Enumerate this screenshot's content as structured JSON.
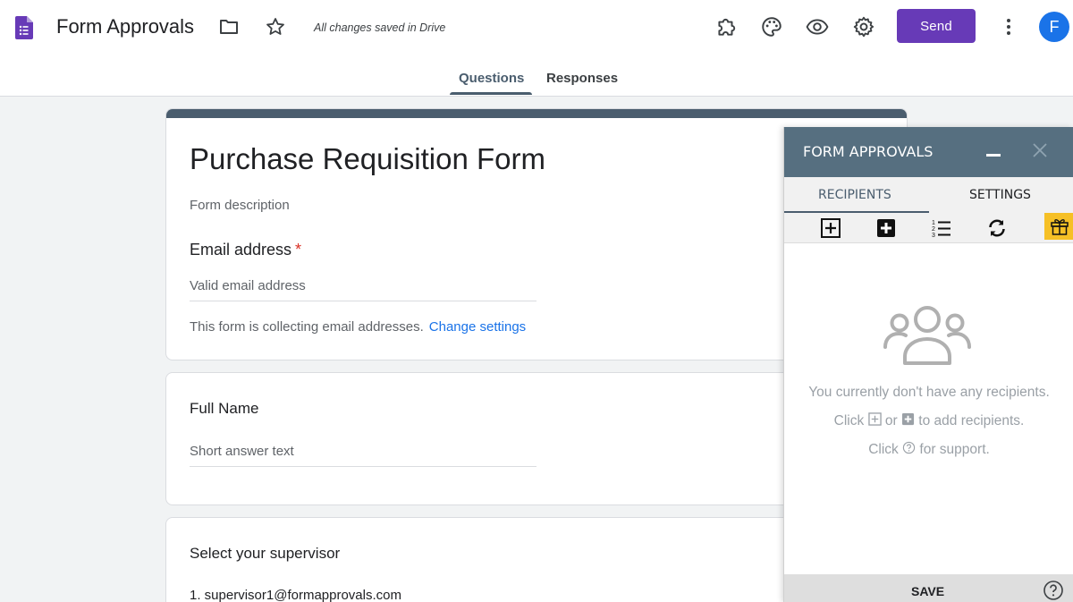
{
  "header": {
    "app_title": "Form Approvals",
    "saved_status": "All changes saved in Drive",
    "send_label": "Send",
    "avatar_initial": "F",
    "icons": [
      "forms-icon",
      "folder-icon",
      "star-icon",
      "addon-icon",
      "palette-icon",
      "preview-icon",
      "settings-icon",
      "more-vert-icon"
    ]
  },
  "tabs": [
    {
      "label": "Questions",
      "active": true
    },
    {
      "label": "Responses",
      "active": false
    }
  ],
  "form": {
    "title": "Purchase Requisition Form",
    "description": "Form description",
    "email_question": {
      "label": "Email address",
      "required_marker": "*",
      "placeholder": "Valid email address",
      "note": "This form is collecting email addresses.",
      "link": "Change settings"
    },
    "full_name_question": {
      "label": "Full Name",
      "placeholder": "Short answer text"
    },
    "supervisor_question": {
      "label": "Select your supervisor",
      "options": [
        "1.  supervisor1@formapprovals.com"
      ]
    }
  },
  "panel": {
    "title": "FORM APPROVALS",
    "tabs": [
      {
        "label": "RECIPIENTS",
        "active": true
      },
      {
        "label": "SETTINGS",
        "active": false
      }
    ],
    "toolbar_icons": [
      "add-outline-icon",
      "add-filled-icon",
      "numbered-list-icon",
      "refresh-icon",
      "gift-icon"
    ],
    "empty_line1": "You currently don't have any recipients.",
    "empty_line2_a": "Click",
    "empty_line2_b": "or",
    "empty_line2_c": "to add recipients.",
    "empty_line3_a": "Click",
    "empty_line3_b": "for support.",
    "save_label": "SAVE"
  },
  "colors": {
    "accent": "#673ab7",
    "theme": "#4a5d6e",
    "panel_header": "#566f80",
    "link": "#1a73e8",
    "gift": "#f6c026"
  }
}
